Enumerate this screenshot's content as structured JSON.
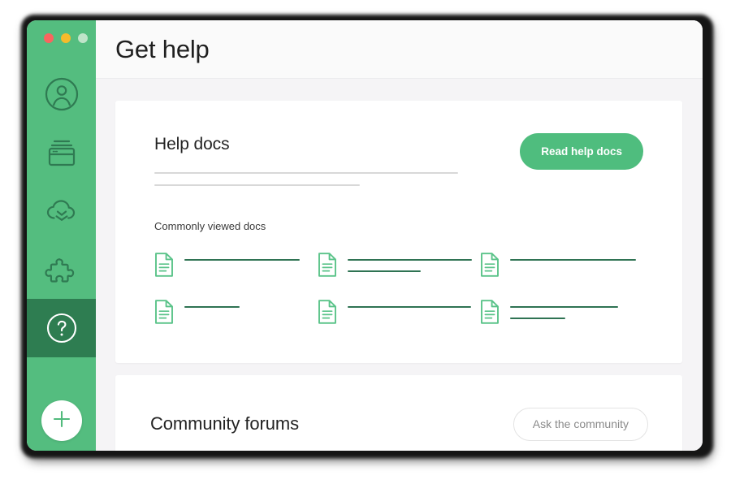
{
  "window": {
    "traffic_lights": [
      {
        "name": "close",
        "color": "#f9655f"
      },
      {
        "name": "minimize",
        "color": "#f6bb2b"
      },
      {
        "name": "zoom",
        "color": "#bfe4c9"
      }
    ]
  },
  "theme": {
    "sidebar_green": "#54bd7f",
    "sidebar_active_green": "#2e7d51",
    "primary_green": "#4fbd7e",
    "doc_line_green": "#2f7353",
    "content_bg": "#f5f4f6",
    "card_bg": "#ffffff",
    "skeleton_gray": "#d8d8d8"
  },
  "sidebar": {
    "items": [
      {
        "name": "account",
        "icon": "user-circle-icon",
        "active": false
      },
      {
        "name": "payments",
        "icon": "card-stack-icon",
        "active": false
      },
      {
        "name": "backups",
        "icon": "cloud-download-icon",
        "active": false
      },
      {
        "name": "integrations",
        "icon": "puzzle-piece-icon",
        "active": false
      },
      {
        "name": "help",
        "icon": "question-circle-icon",
        "active": true
      }
    ],
    "fab": {
      "icon": "plus-icon",
      "label": "Create new"
    }
  },
  "header": {
    "title": "Get help"
  },
  "help_docs": {
    "title": "Help docs",
    "read_button_label": "Read help docs",
    "skeleton_lines": [
      374,
      253
    ],
    "commonly_viewed_label": "Commonly viewed docs",
    "docs": [
      {
        "icon": "document-icon",
        "lines": [
          142
        ]
      },
      {
        "icon": "document-icon",
        "lines": [
          153,
          90
        ]
      },
      {
        "icon": "document-icon",
        "lines": [
          155
        ]
      },
      {
        "icon": "document-icon",
        "lines": [
          68
        ]
      },
      {
        "icon": "document-icon",
        "lines": [
          152
        ]
      },
      {
        "icon": "document-icon",
        "lines": [
          133,
          68
        ]
      }
    ]
  },
  "community_forums": {
    "title": "Community forums",
    "ask_button_label": "Ask the community"
  }
}
